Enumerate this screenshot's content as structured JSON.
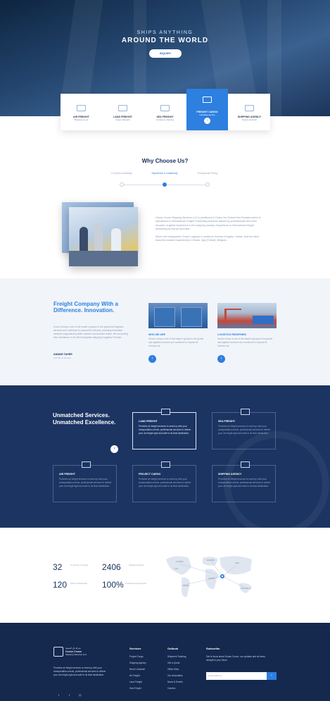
{
  "hero": {
    "subtitle": "SHIPS ANYTHING",
    "title": "AROUND THE WORLD",
    "button": "INQUIRY"
  },
  "service_cards": [
    {
      "title": "AIR FREIGHT",
      "sub": "Shipping by air",
      "icon": "airplane-icon"
    },
    {
      "title": "LAND FREIGHT",
      "sub": "Cargo transport",
      "icon": "truck-icon"
    },
    {
      "title": "SEA FREIGHT",
      "sub": "Container shipping",
      "icon": "ship-icon"
    },
    {
      "title": "FREIGHT CARGO",
      "sub": "Handling service",
      "icon": "cargo-icon",
      "active": true,
      "button": "›"
    },
    {
      "title": "SHIPPING AGENCY",
      "sub": "Expert services",
      "icon": "agency-icon"
    }
  ],
  "why": {
    "title": "Why Choose Us?",
    "steps": [
      "In Depth Knowledge",
      "Experience & Leadership",
      "Exceptional Pricing"
    ],
    "active_step": 1,
    "paragraphs": [
      "Ocean Crown Shipping Services LLC is positioned in Dubai, the Global Hub Emirates which is specialized in International Freight Forwarding business started by professionals who have decades of global experience in the shipping industry. Experience in International freight forwarding by sea air and land.",
      "Where the headquarter Crown Logistics is located in Amman & Agaba, Jordan. And the other branches located respectively in Ghana, Italy (Trieste), Belgium."
    ]
  },
  "freight": {
    "title": "Freight Company With a Difference. Innovation.",
    "body": "Crown Group is one of the leader's groups in the global and logistics services as it continues to expand its horizons, providing innovative solutions supported by skills, wisdom and decisive action. We are joining with confidence, to be the best global shipping & logistics Provider.",
    "name": "ANWAR TAHER",
    "role": "Founder & director",
    "items": [
      {
        "title": "WHO WE ARE",
        "text": "Ocean Group is one of the leader's groups in the global and logistics services as it continues to expand its horizons by.",
        "button": "›"
      },
      {
        "title": "LOGISTICS REDEFINED",
        "text": "Ocean Group is one of the leader's groups in the global and logistics services as it continues to expand its horizons by.",
        "button": "›"
      }
    ]
  },
  "unmatched": {
    "title": "Unmatched Services. Unmatched Excellence.",
    "arrow": "›",
    "cards": [
      {
        "title": "LAND FREIGHT",
        "icon": "truck-icon",
        "text": "Provides air freight services to meet up with your transportation needs, professional services to deliver your air freight right and safe to its final destination.",
        "highlight": true
      },
      {
        "title": "SEA FREIGHT",
        "icon": "ship-icon",
        "text": "Provides air freight services to meet up with your transportation needs, professional services to deliver your air freight right and safe to its final destination.",
        "highlight": false
      },
      {
        "title": "AIR FREIGHT",
        "icon": "airplane-icon",
        "text": "Provides air freight services to meet up with your transportation needs, professional services to deliver your air freight right and safe to its final destination.",
        "highlight": false
      },
      {
        "title": "PROJECT CARGO",
        "icon": "truck-icon",
        "text": "Provides air freight services to meet up with your transportation needs, professional services to deliver your air freight right and safe to its final destination.",
        "highlight": false
      },
      {
        "title": "SHIPPING AGENCY",
        "icon": "agency-icon",
        "text": "Provides air freight services to meet up with your transportation needs, professional services to deliver your air freight right and safe to its final destination.",
        "highlight": false
      }
    ]
  },
  "stats": [
    {
      "value": "32",
      "label": "Countries Covered"
    },
    {
      "value": "2406",
      "label": "Satisfied Clients"
    },
    {
      "value": "120",
      "label": "Offices Worldwide"
    },
    {
      "value": "100%",
      "label": "Professional Approach"
    }
  ],
  "map_labels": [
    "CANADA",
    "EUROPE",
    "USA",
    "AFRICA",
    "ASIA",
    "BRAZIL",
    "AUSTRALIA"
  ],
  "footer": {
    "brand_line1": "شركة تاج المحيط",
    "brand_line2": "Ocean Crown",
    "brand_line3": "Shipping Services LLC",
    "desc": "Provides air freight services to meet up with your transportation needs, professional services to deliver your air freight right and safe to its final destination.",
    "social": [
      "t",
      "f",
      "◎"
    ],
    "services_title": "Services",
    "services": [
      "Project Cargo",
      "Shipping Agency",
      "Need Container",
      "Air Freight",
      "Land Freight",
      "Sea Freight"
    ],
    "outlook_title": "Outlook",
    "outlook": [
      "Shipment Tracking",
      "Get a Quote",
      "Office Sites",
      "Our Associates",
      "News & Events",
      "Careers"
    ],
    "subscribe_title": "Subscribe",
    "subscribe_text": "Get to know about Ocean Crown, our updates and all news, straight to your inbox.",
    "email_placeholder": "Email address",
    "go": "›"
  }
}
